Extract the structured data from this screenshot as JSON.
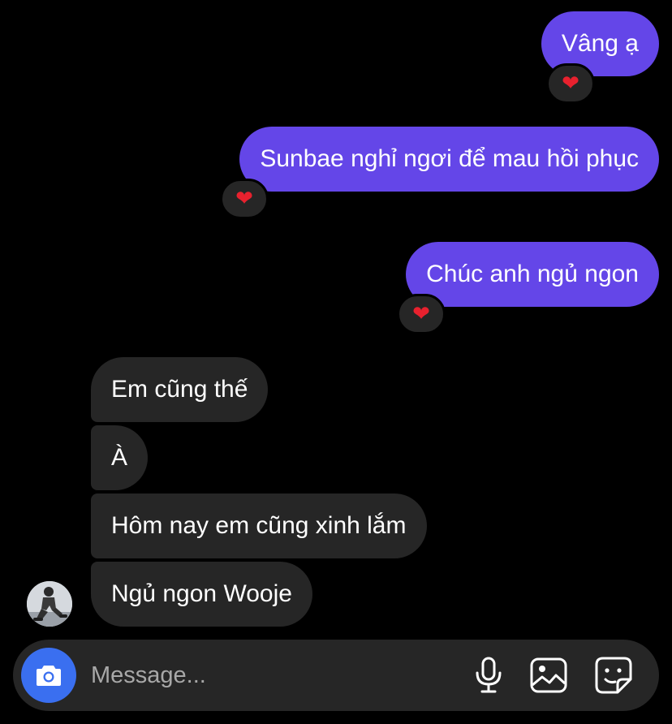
{
  "colors": {
    "background": "#000000",
    "sent_bubble": "#6446e8",
    "received_bubble": "#262626",
    "camera_button": "#3a6ff0",
    "heart": "#e8212e",
    "placeholder": "#a8a8a8"
  },
  "messages": {
    "sent": [
      {
        "text": "Vâng ạ",
        "reaction": "❤"
      },
      {
        "text": "Sunbae nghỉ ngơi để mau hồi phục",
        "reaction": "❤"
      },
      {
        "text": "Chúc anh ngủ ngon",
        "reaction": "❤"
      }
    ],
    "received": [
      {
        "text": "Em cũng thế"
      },
      {
        "text": "À"
      },
      {
        "text": "Hôm nay em cũng xinh lắm"
      },
      {
        "text": "Ngủ ngon Wooje"
      }
    ]
  },
  "composer": {
    "placeholder": "Message...",
    "value": "",
    "icons": [
      "camera-icon",
      "microphone-icon",
      "photo-gallery-icon",
      "sticker-icon"
    ]
  }
}
